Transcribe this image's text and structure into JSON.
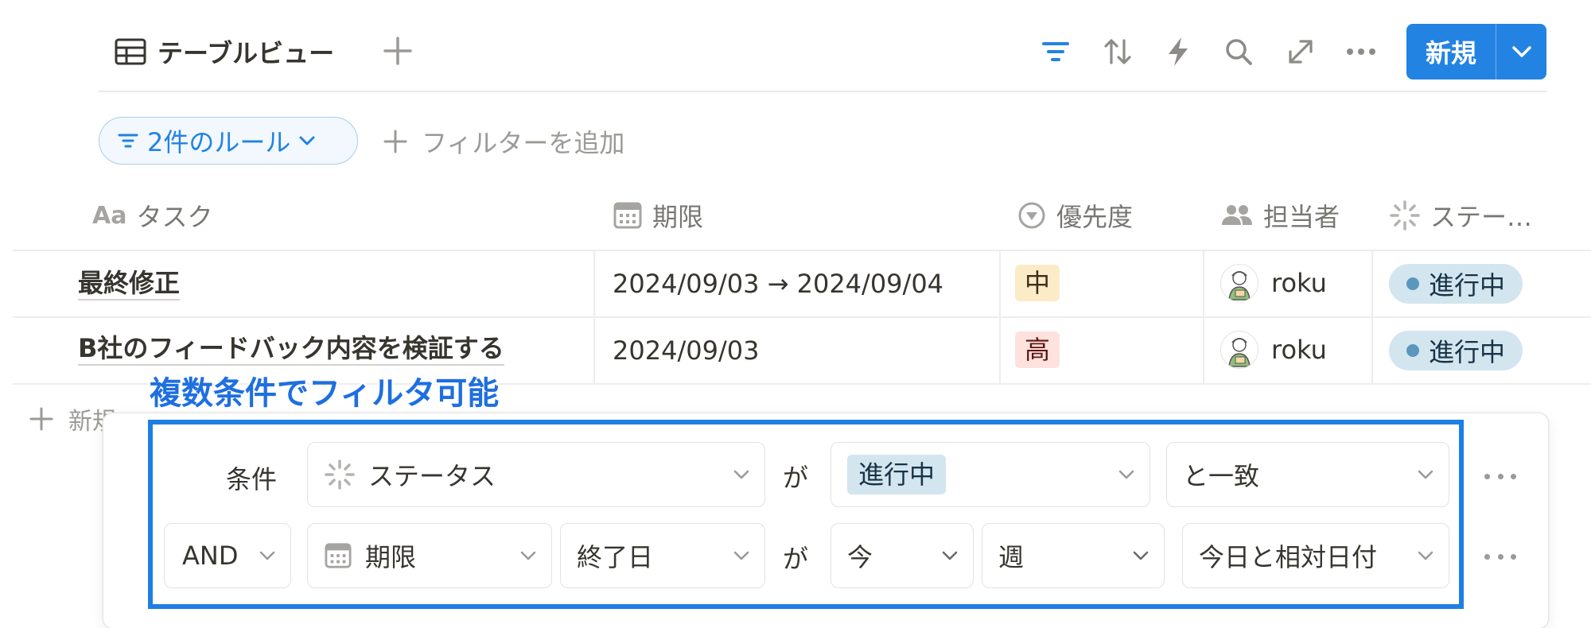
{
  "toolbar": {
    "view_name": "テーブルビュー",
    "new_button": "新規",
    "accent": "#2383e2"
  },
  "filters": {
    "rule_chip": "2件のルール",
    "add_filter": "フィルターを追加"
  },
  "columns": [
    {
      "prefix": "Aa",
      "label": "タスク"
    },
    {
      "label": "期限"
    },
    {
      "label": "優先度"
    },
    {
      "label": "担当者"
    },
    {
      "label": "ステー…"
    }
  ],
  "rows": [
    {
      "task": "最終修正",
      "due": "2024/09/03 → 2024/09/04",
      "priority": "中",
      "assignee": "roku",
      "status": "進行中"
    },
    {
      "task": "B社のフィードバック内容を検証する",
      "due": "2024/09/03",
      "priority": "高",
      "assignee": "roku",
      "status": "進行中"
    }
  ],
  "new_row_label": "新規",
  "annotation": "複数条件でフィルタ可能",
  "filter_rules": [
    {
      "label": "条件",
      "property": "ステータス",
      "connector": "が",
      "value": "進行中",
      "operator": "と一致"
    },
    {
      "logic": "AND",
      "property": "期限",
      "field": "終了日",
      "connector": "が",
      "relative": "今",
      "unit": "週",
      "operator": "今日と相対日付"
    }
  ]
}
